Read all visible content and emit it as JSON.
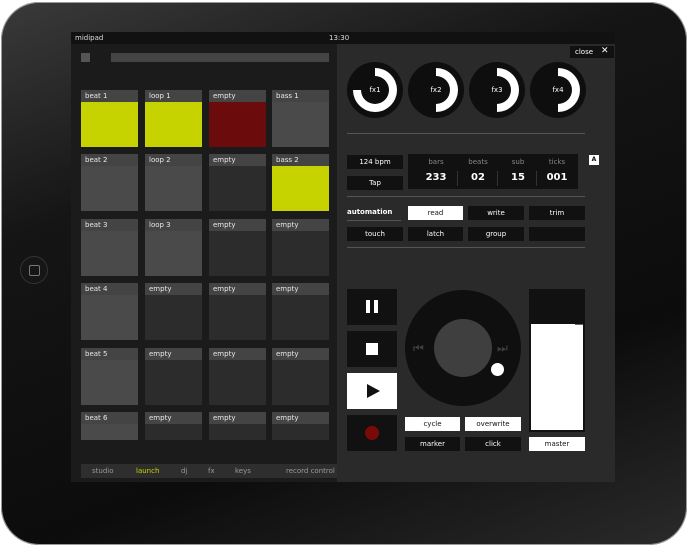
{
  "status": {
    "carrier": "midipad",
    "time": "13:30"
  },
  "pads": [
    {
      "label": "beat 1",
      "state": "lime"
    },
    {
      "label": "loop 1",
      "state": "lime"
    },
    {
      "label": "empty",
      "state": "red"
    },
    {
      "label": "bass 1",
      "state": "gray"
    },
    {
      "label": "beat 2",
      "state": "gray"
    },
    {
      "label": "loop 2",
      "state": "gray"
    },
    {
      "label": "empty",
      "state": "dark"
    },
    {
      "label": "bass 2",
      "state": "lime"
    },
    {
      "label": "beat 3",
      "state": "gray"
    },
    {
      "label": "loop 3",
      "state": "gray"
    },
    {
      "label": "empty",
      "state": "dark"
    },
    {
      "label": "empty",
      "state": "dark"
    },
    {
      "label": "beat 4",
      "state": "gray"
    },
    {
      "label": "empty",
      "state": "dark"
    },
    {
      "label": "empty",
      "state": "dark"
    },
    {
      "label": "empty",
      "state": "dark"
    },
    {
      "label": "beat 5",
      "state": "gray"
    },
    {
      "label": "empty",
      "state": "dark"
    },
    {
      "label": "empty",
      "state": "dark"
    },
    {
      "label": "empty",
      "state": "dark"
    },
    {
      "label": "beat 6",
      "state": "gray"
    },
    {
      "label": "empty",
      "state": "dark"
    },
    {
      "label": "empty",
      "state": "dark"
    },
    {
      "label": "empty",
      "state": "dark"
    }
  ],
  "tabs": [
    {
      "label": "studio",
      "active": false
    },
    {
      "label": "launch",
      "active": true
    },
    {
      "label": "dj",
      "active": false
    },
    {
      "label": "fx",
      "active": false
    },
    {
      "label": "keys",
      "active": false
    }
  ],
  "record_tab": "record control",
  "close": {
    "label": "close",
    "icon": "close-icon"
  },
  "fx_knobs": [
    {
      "label": "fx1",
      "level": 0.75
    },
    {
      "label": "fx2",
      "level": 0.5
    },
    {
      "label": "fx3",
      "level": 0.5
    },
    {
      "label": "fx4",
      "level": 0.5
    }
  ],
  "tempo": {
    "bpm": "124 bpm",
    "tap": "Tap"
  },
  "counter": {
    "headers": [
      "bars",
      "beats",
      "sub",
      "ticks"
    ],
    "values": [
      "233",
      "02",
      "15",
      "001"
    ]
  },
  "a_badge": "A",
  "automation": {
    "label": "automation",
    "buttons": [
      "read",
      "write",
      "trim",
      "touch",
      "latch",
      "group",
      ""
    ]
  },
  "transport": {
    "pause": "pause-icon",
    "stop": "stop-icon",
    "play": "play-icon",
    "record": "record-icon"
  },
  "wheel": {
    "prev": "skip-back-icon",
    "next": "skip-forward-icon"
  },
  "bottom_buttons": [
    "cycle",
    "overwrite",
    "marker",
    "click",
    "master"
  ],
  "master_level": 0.76,
  "colors": {
    "lime": "#c6d300",
    "red": "#6b0b0b",
    "record": "#7a0a0a"
  }
}
